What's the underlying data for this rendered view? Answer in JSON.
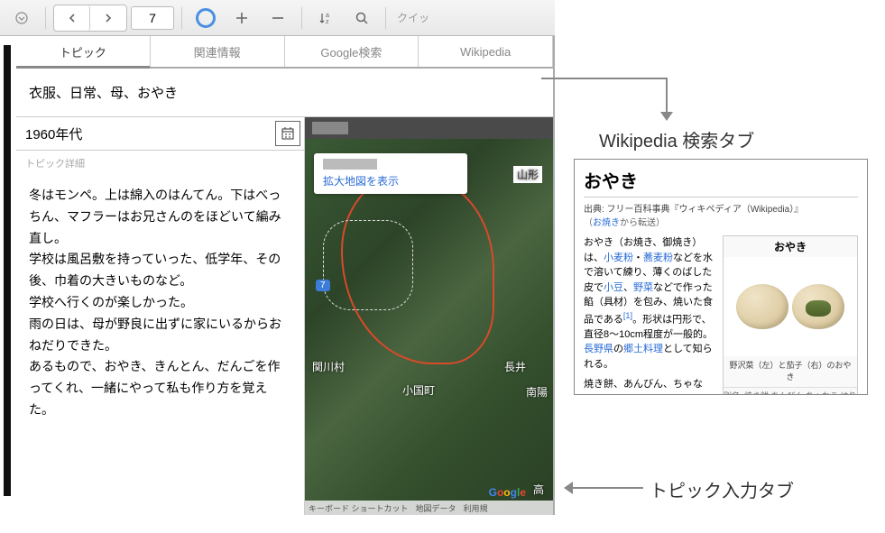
{
  "toolbar": {
    "page_value": "7",
    "quick_label": "クイッ"
  },
  "tabs": [
    {
      "label": "トピック"
    },
    {
      "label": "関連情報"
    },
    {
      "label": "Google検索"
    },
    {
      "label": "Wikipedia"
    }
  ],
  "topic_line": "衣服、日常、母、おやき",
  "year_value": "1960年代",
  "detail_label": "トピック詳細",
  "detail_body": "冬はモンペ。上は綿入のはんてん。下はべっちん、マフラーはお兄さんのをほどいて編み直し。\n学校は風呂敷を持っていった、低学年、その後、巾着の大きいものなど。\n学校へ行くのが楽しかった。\n雨の日は、母が野良に出ずに家にいるからおねだりできた。\nあるもので、おやき、きんとん、だんごを作ってくれ、一緒にやって私も作り方を覚えた。",
  "map": {
    "enlarge_link": "拡大地図を表示",
    "label_yamagata": "山形",
    "label_nagai": "長井",
    "label_oguni": "小国町",
    "label_sekikawa": "関川村",
    "label_nanyou": "南陽",
    "label_taka": "高",
    "badge_7": "7",
    "footer_shortcut": "キーボード ショートカット",
    "footer_mapdata": "地図データ",
    "footer_terms": "利用規"
  },
  "annotations": {
    "wiki_tab": "Wikipedia 検索タブ",
    "topic_tab": "トピック入力タブ"
  },
  "wiki": {
    "title": "おやき",
    "subtitle": "出典: フリー百科事典『ウィキペディア（Wikipedia）』",
    "redirect_prefix": "（",
    "redirect_link": "お焼き",
    "redirect_suffix": "から転送）",
    "body_1": "おやき（お焼き、御焼き）は、",
    "link_1": "小麦粉",
    "body_2": "・",
    "link_2": "蕎麦粉",
    "body_3": "などを水で溶いて練り、薄くのばした皮で",
    "link_3": "小豆",
    "body_4": "、",
    "link_4": "野菜",
    "body_5": "などで作った",
    "link_5": "餡（具材）",
    "body_6": "を包み、焼いた食品である",
    "ref_1": "[1]",
    "body_7": "。形状は円形で、直径8～10cm程度が一般的。",
    "link_6": "長野県",
    "body_8": "の",
    "link_7": "郷土料理",
    "body_9": "として知られる。",
    "row2": "焼き餅、あんびん、ちゃなこ、はりこしなどとも呼ば",
    "infobox_title": "おやき",
    "caption": "野沢菜（左）と茄子（右）のおやき",
    "bottom_label": "別名",
    "bottom_value": "焼き餅 あんびん ちゃなこ はり"
  }
}
